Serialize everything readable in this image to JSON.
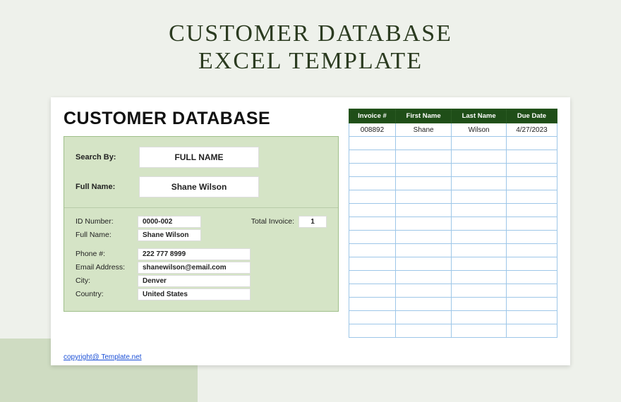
{
  "page": {
    "title_line1": "CUSTOMER DATABASE",
    "title_line2": "EXCEL TEMPLATE"
  },
  "card": {
    "heading": "CUSTOMER DATABASE",
    "search": {
      "search_by_label": "Search By:",
      "search_by_value": "FULL NAME",
      "full_name_label": "Full Name:",
      "full_name_value": "Shane Wilson"
    },
    "details": {
      "id_label": "ID Number:",
      "id_value": "0000-002",
      "total_invoice_label": "Total Invoice:",
      "total_invoice_value": "1",
      "fullname_label": "Full Name:",
      "fullname_value": "Shane Wilson",
      "phone_label": "Phone #:",
      "phone_value": "222 777 8999",
      "email_label": "Email Address:",
      "email_value": "shanewilson@email.com",
      "city_label": "City:",
      "city_value": "Denver",
      "country_label": "Country:",
      "country_value": "United States"
    },
    "table": {
      "headers": [
        "Invoice #",
        "First Name",
        "Last Name",
        "Due Date"
      ],
      "rows": [
        {
          "invoice": "008892",
          "first": "Shane",
          "last": "Wilson",
          "due": "4/27/2023"
        }
      ],
      "empty_rows": 15
    },
    "copyright": "copyright@ Template.net"
  }
}
